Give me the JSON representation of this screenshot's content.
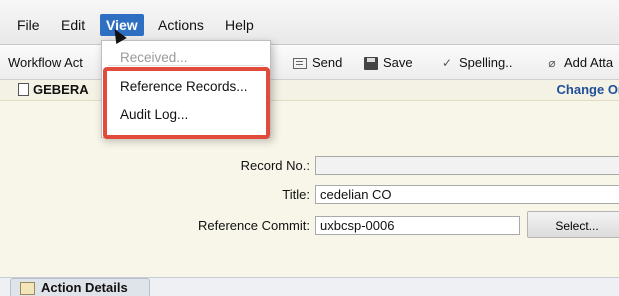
{
  "menubar": {
    "items": [
      "File",
      "Edit",
      "View",
      "Actions",
      "Help"
    ],
    "active": "View"
  },
  "toolbar": {
    "workflow_label": "Workflow Act",
    "send_label": "Send",
    "save_label": "Save",
    "spelling_label": "Spelling..",
    "attach_label": "Add Atta"
  },
  "subheader": {
    "title": "GEBERA",
    "change_link": "Change Or"
  },
  "view_menu": {
    "items": [
      {
        "label": "Received...",
        "enabled": false
      },
      {
        "label": "Reference Records...",
        "enabled": true
      },
      {
        "label": "Audit Log...",
        "enabled": true
      }
    ]
  },
  "form": {
    "record_no_label": "Record No.:",
    "record_no_value": "",
    "title_label": "Title:",
    "title_value": "cedelian CO",
    "ref_commit_label": "Reference Commit:",
    "ref_commit_value": "uxbcsp-0006",
    "select_button": "Select..."
  },
  "bottom_tab": {
    "label": "Action Details"
  },
  "colors": {
    "menu_active": "#2f6fc1",
    "highlight": "#e04b3c",
    "form_bg": "#f8f6e8",
    "link": "#1f4f99"
  }
}
